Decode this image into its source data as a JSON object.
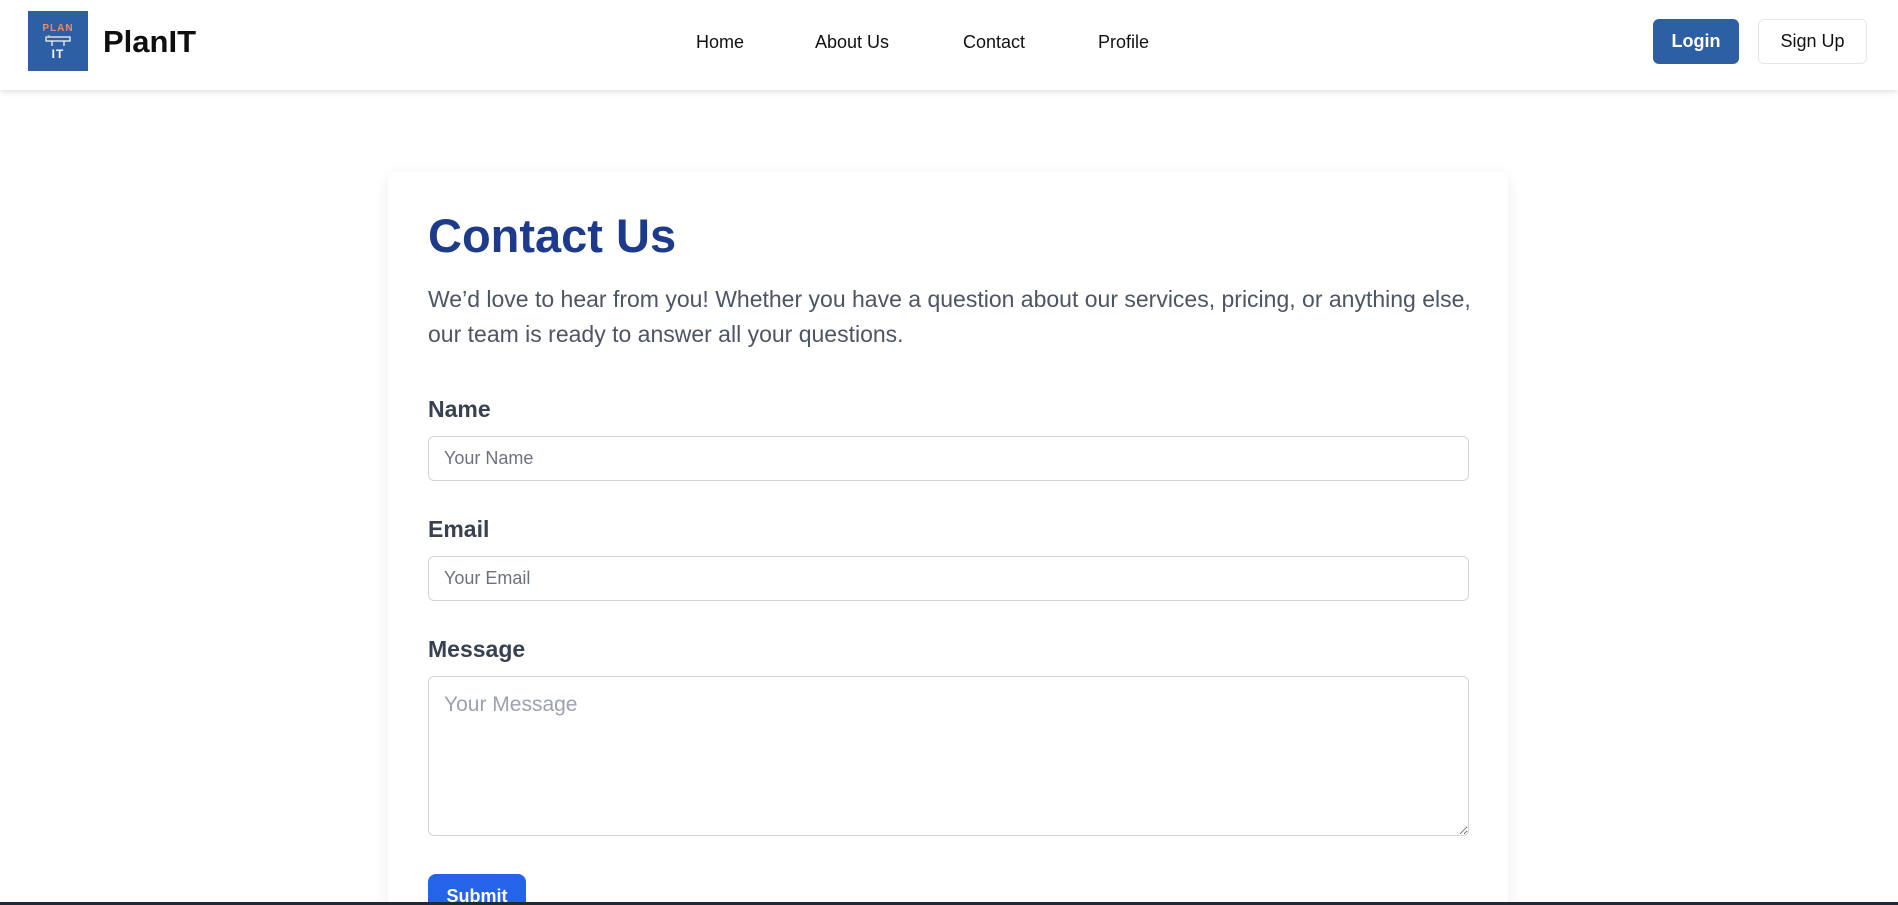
{
  "header": {
    "logo": {
      "line1": "PLAN",
      "line2": "IT",
      "icon": "planit-logo-mark"
    },
    "brand": "PlanIT",
    "nav": [
      "Home",
      "About Us",
      "Contact",
      "Profile"
    ],
    "login_label": "Login",
    "signup_label": "Sign Up"
  },
  "contact": {
    "title": "Contact Us",
    "intro": "We’d love to hear from you! Whether you have a question about our services, pricing, or anything else, our team is ready to answer all your questions.",
    "name_label": "Name",
    "name_placeholder": "Your Name",
    "name_value": "",
    "email_label": "Email",
    "email_placeholder": "Your Email",
    "email_value": "",
    "message_label": "Message",
    "message_placeholder": "Your Message",
    "message_value": "",
    "submit_label": "Submit"
  },
  "colors": {
    "brand_blue": "#2c5fa3",
    "title_blue": "#1e3a8a",
    "submit_blue": "#2563eb",
    "logo_accent": "#f08a6a"
  }
}
